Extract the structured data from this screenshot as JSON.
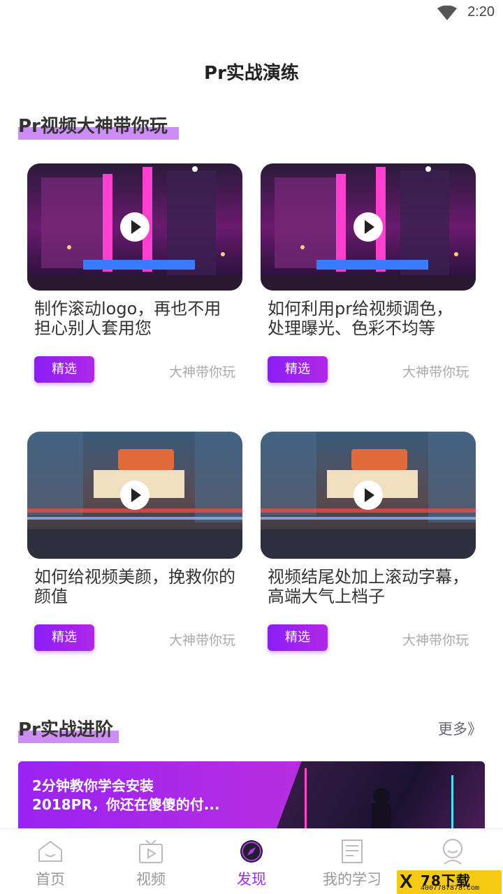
{
  "status_bar": {
    "time": "2:20"
  },
  "page": {
    "title": "Pr实战演练"
  },
  "section1": {
    "heading": "Pr视频大神带你玩",
    "cards": [
      {
        "title": "制作滚动logo，再也不用担心别人套用您",
        "tag": "精选",
        "author": "大神带你玩"
      },
      {
        "title": "如何利用pr给视频调色，处理曝光、色彩不均等",
        "tag": "精选",
        "author": "大神带你玩"
      },
      {
        "title": "如何给视频美颜，挽救你的颜值",
        "tag": "精选",
        "author": "大神带你玩"
      },
      {
        "title": "视频结尾处加上滚动字幕，高端大气上档子",
        "tag": "精选",
        "author": "大神带你玩"
      }
    ]
  },
  "section2": {
    "heading": "Pr实战进阶",
    "more": "更多》",
    "banner_line1": "2分钟教你学会安装",
    "banner_line2": "2018PR，你还在傻傻的付..."
  },
  "tabbar": {
    "tabs": [
      {
        "label": "首页",
        "icon": "home-icon"
      },
      {
        "label": "视频",
        "icon": "tv-icon"
      },
      {
        "label": "发现",
        "icon": "compass-icon"
      },
      {
        "label": "我的学习",
        "icon": "document-icon"
      },
      {
        "label": "",
        "icon": "profile-icon"
      }
    ],
    "active_index": 2
  },
  "watermark": {
    "mark": "X",
    "text": "78下载",
    "phone": "4007787878.com"
  },
  "colors": {
    "accent": "#9b2ee0",
    "tag_gradient_start": "#8a1ef5",
    "highlight": "#cc8df5"
  }
}
